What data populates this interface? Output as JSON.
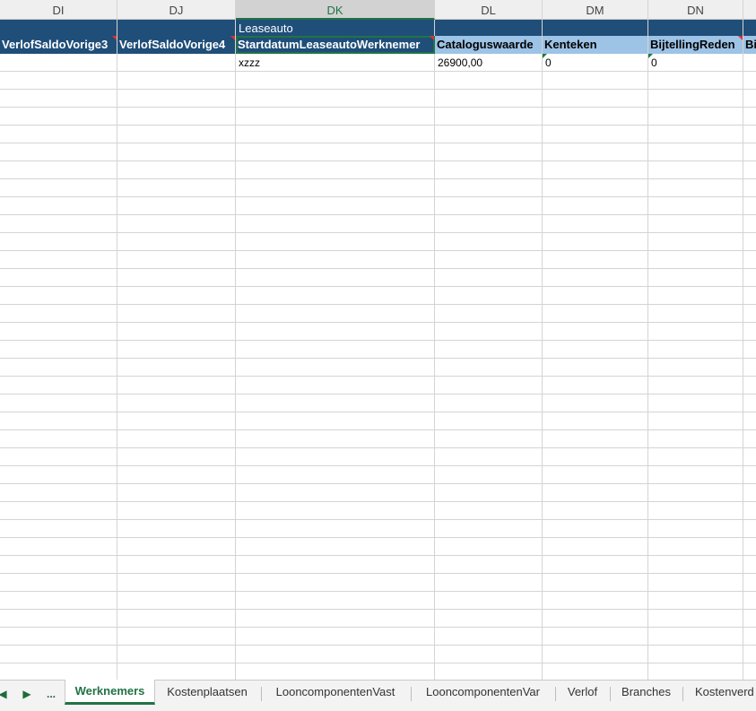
{
  "columns": [
    "DI",
    "DJ",
    "DK",
    "DL",
    "DM",
    "DN"
  ],
  "band": {
    "label": "Leaseauto"
  },
  "headers": [
    {
      "label": "VerlofSaldoVorige3",
      "style": "dark",
      "comment": true
    },
    {
      "label": "VerlofSaldoVorige4",
      "style": "dark",
      "comment": true
    },
    {
      "label": "StartdatumLeaseautoWerknemer",
      "style": "dark",
      "comment": true
    },
    {
      "label": "Cataloguswaarde",
      "style": "light",
      "comment": false
    },
    {
      "label": "Kenteken",
      "style": "light",
      "comment": false
    },
    {
      "label": "BijtellingReden",
      "style": "light",
      "comment": true
    },
    {
      "label": "Bi",
      "style": "light",
      "comment": false
    }
  ],
  "row1": {
    "startdatum": "xzzz",
    "cataloguswaarde": "26900,00",
    "kenteken": "0",
    "bijtellingreden": "0"
  },
  "tabs": {
    "more": "...",
    "items": [
      "Werknemers",
      "Kostenplaatsen",
      "LooncomponentenVast",
      "LooncomponentenVar",
      "Verlof",
      "Branches",
      "Kostenverd"
    ],
    "active": "Werknemers"
  },
  "colors": {
    "header_dark": "#1f4e79",
    "header_light": "#9dc3e6",
    "accent": "#217346"
  }
}
